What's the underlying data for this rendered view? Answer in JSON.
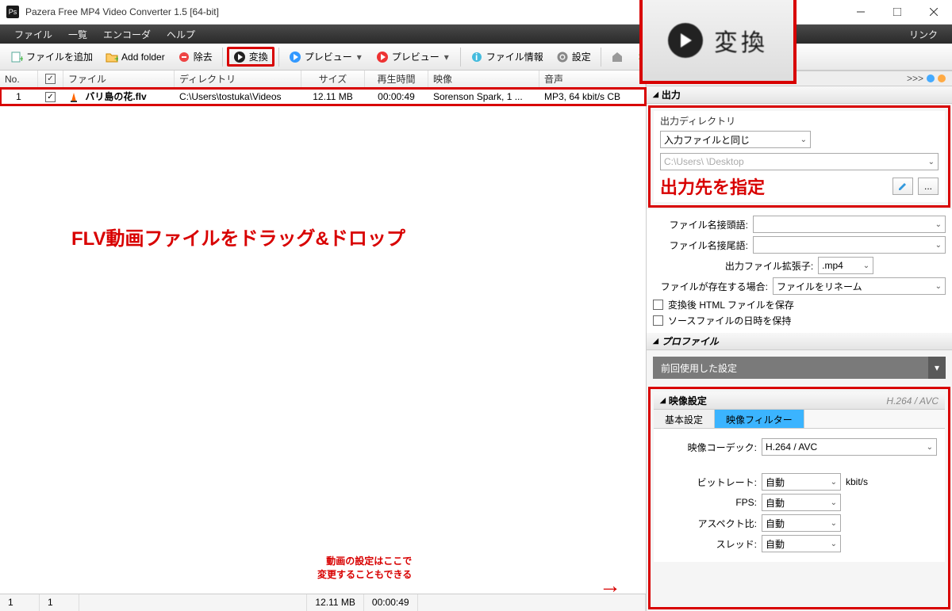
{
  "window": {
    "title": "Pazera Free MP4 Video Converter 1.5  [64-bit]",
    "icon_text": "Ps"
  },
  "menu": {
    "file": "ファイル",
    "list": "一覧",
    "encoder": "エンコーダ",
    "help": "ヘルプ",
    "links": "リンク"
  },
  "toolbar": {
    "add_file": "ファイルを追加",
    "add_folder": "Add folder",
    "remove": "除去",
    "convert": "変換",
    "preview1": "プレビュー",
    "preview2": "プレビュー",
    "file_info": "ファイル情報",
    "settings": "設定"
  },
  "big_button": {
    "label": "変換"
  },
  "grid": {
    "cols": {
      "no": "No.",
      "file": "ファイル",
      "dir": "ディレクトリ",
      "size": "サイズ",
      "dur": "再生時間",
      "video": "映像",
      "audio": "音声"
    },
    "rows": [
      {
        "no": "1",
        "file": "バリ島の花.flv",
        "dir": "C:\\Users\\tostuka\\Videos",
        "size": "12.11 MB",
        "dur": "00:00:49",
        "video": "Sorenson Spark, 1 ...",
        "audio": "MP3, 64 kbit/s CB"
      }
    ]
  },
  "status": {
    "left1": "1",
    "left2": "1",
    "size": "12.11 MB",
    "dur": "00:00:49"
  },
  "annotations": {
    "drag": "FLV動画ファイルをドラッグ&ドロップ",
    "settings_l1": "動画の設定はここで",
    "settings_l2": "変更することもできる",
    "output_dest": "出力先を指定"
  },
  "right": {
    "more": ">>>",
    "output_title": "出力",
    "out_dir_label": "出力ディレクトリ",
    "out_dir_value": "入力ファイルと同じ",
    "out_path": "C:\\Users\\        \\Desktop",
    "prefix_label": "ファイル名接頭語:",
    "prefix_value": "",
    "suffix_label": "ファイル名接尾語:",
    "suffix_value": "",
    "ext_label": "出力ファイル拡張子:",
    "ext_value": ".mp4",
    "exists_label": "ファイルが存在する場合:",
    "exists_value": "ファイルをリネーム",
    "save_html": "変換後 HTML ファイルを保存",
    "keep_date": "ソースファイルの日時を保持",
    "profile_title": "プロファイル",
    "profile_value": "前回使用した設定",
    "video_title": "映像設定",
    "video_codec_hint": "H.264 / AVC",
    "tab_basic": "基本設定",
    "tab_filter": "映像フィルター",
    "codec_label": "映像コーデック:",
    "codec_value": "H.264 / AVC",
    "bitrate_label": "ビットレート:",
    "bitrate_value": "自動",
    "bitrate_unit": "kbit/s",
    "fps_label": "FPS:",
    "fps_value": "自動",
    "aspect_label": "アスペクト比:",
    "aspect_value": "自動",
    "thread_label": "スレッド:",
    "thread_value": "自動"
  }
}
